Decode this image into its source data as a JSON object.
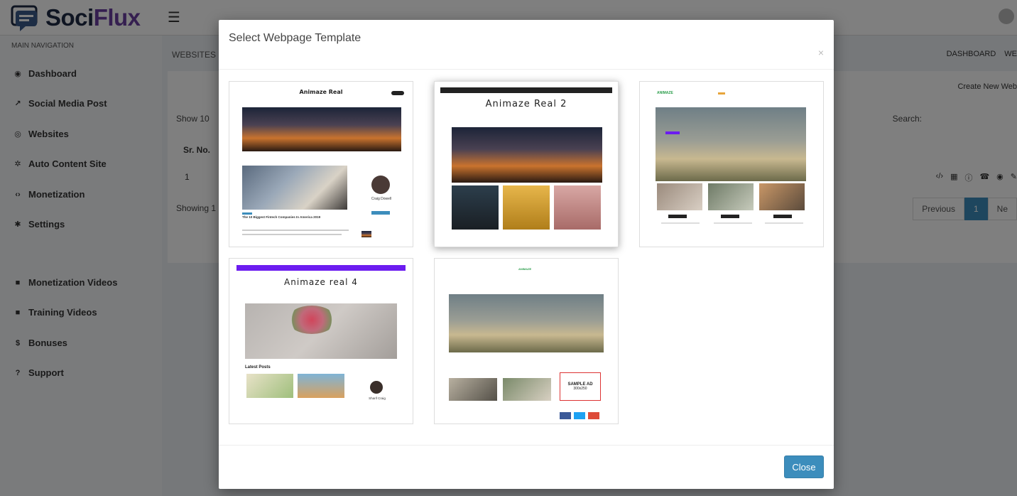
{
  "app": {
    "logo_a": "Soci",
    "logo_b": "Flux",
    "menu_icon": "hamburger-icon",
    "user_icon": "user-avatar-icon"
  },
  "sidebar": {
    "header": "MAIN NAVIGATION",
    "items": [
      {
        "label": "Dashboard",
        "icon": "dashboard-icon"
      },
      {
        "label": "Social Media Post",
        "icon": "share-icon"
      },
      {
        "label": "Websites",
        "icon": "globe-icon"
      },
      {
        "label": "Auto Content Site",
        "icon": "cog-icon"
      },
      {
        "label": "Monetization",
        "icon": "code-icon"
      },
      {
        "label": "Settings",
        "icon": "gear-icon"
      },
      {
        "label": "Monetization Videos",
        "icon": "video-icon"
      },
      {
        "label": "Training Videos",
        "icon": "video-icon"
      },
      {
        "label": "Bonuses",
        "icon": "dollar-icon"
      },
      {
        "label": "Support",
        "icon": "help-icon"
      }
    ]
  },
  "content": {
    "breadcrumb_left": "WEBSITES",
    "breadcrumb_right": [
      "DASHBOARD",
      "WE"
    ],
    "create_button": "Create New Web",
    "show_label": "Show",
    "show_value": "10",
    "search_label": "Search:",
    "table_header_sr": "Sr. No.",
    "row_sr": "1",
    "showing": "Showing 1",
    "pager": {
      "previous": "Previous",
      "current": "1",
      "next": "Ne"
    }
  },
  "modal": {
    "title": "Select Webpage Template",
    "close_x": "×",
    "close_button": "Close",
    "templates": [
      {
        "title": "Animaze Real",
        "subtitle": "The 10 Biggest Fintech Companies In America 2019",
        "author": "Craig Dowell"
      },
      {
        "title": "Animaze Real 2"
      },
      {
        "title": "ANIMAZE"
      },
      {
        "title": "Animaze real 4",
        "section": "Latest Posts",
        "author": "Sharif Craig"
      },
      {
        "title": "ANIMAZE",
        "ad": "SAMPLE AD",
        "ad_size": "300x250"
      }
    ]
  },
  "colors": {
    "brand_dark": "#1f2a44",
    "brand_purple": "#6b3fa0",
    "primary_button": "#3c8dbc",
    "template_accent": "#6c1cf0"
  }
}
